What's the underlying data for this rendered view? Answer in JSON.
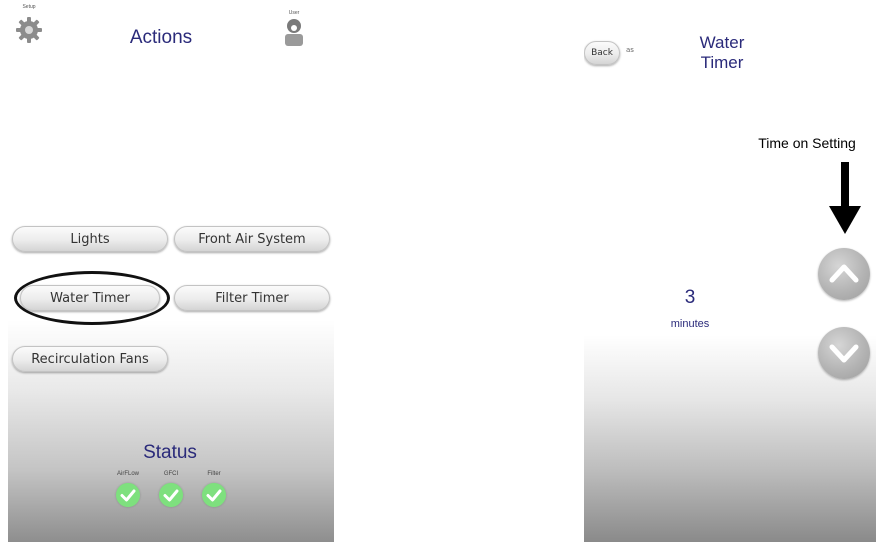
{
  "left_screen": {
    "setup_label": "Setup",
    "user_label": "User",
    "title": "Actions",
    "buttons": {
      "lights": "Lights",
      "front_air": "Front Air System",
      "water_timer": "Water Timer",
      "filter_timer": "Filter Timer",
      "recirculation": "Recirculation Fans"
    },
    "status": {
      "title": "Status",
      "items": [
        {
          "label": "AirFLow",
          "state": "ok"
        },
        {
          "label": "GFCI",
          "state": "ok"
        },
        {
          "label": "Filter",
          "state": "ok"
        }
      ]
    }
  },
  "right_screen": {
    "back_label": "Back",
    "side_text": "as",
    "title_line1": "Water",
    "title_line2": "Timer",
    "value": "3",
    "unit": "minutes"
  },
  "annotation": {
    "text": "Time on Setting"
  },
  "colors": {
    "title": "#2a2a7a",
    "check": "#7ee07e",
    "arrow": "#000000"
  }
}
